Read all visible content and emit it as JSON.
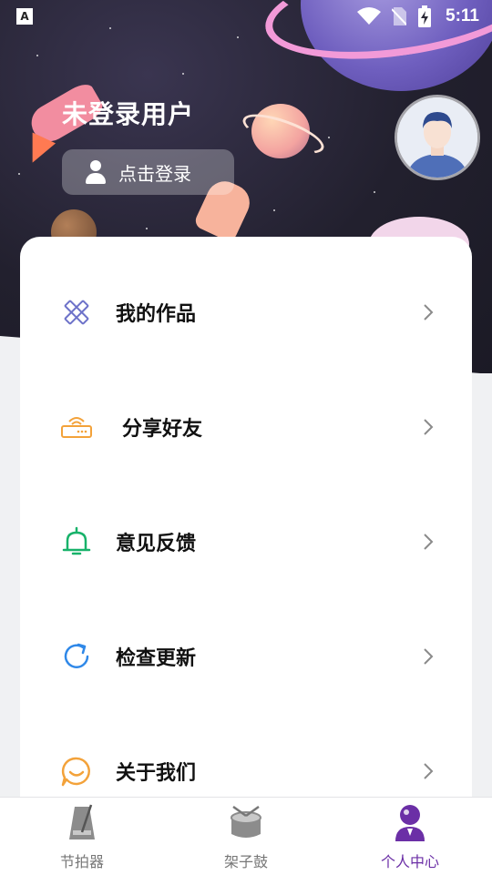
{
  "status_bar": {
    "time": "5:11",
    "app_icon_letter": "A"
  },
  "profile": {
    "username": "未登录用户",
    "login_label": "点击登录"
  },
  "menu": [
    {
      "label": "我的作品",
      "icon": "pencil-ruler-icon",
      "color": "#6d72c9"
    },
    {
      "label": "分享好友",
      "icon": "router-icon",
      "color": "#f3a23a"
    },
    {
      "label": "意见反馈",
      "icon": "bell-icon",
      "color": "#18b26a"
    },
    {
      "label": "检查更新",
      "icon": "refresh-icon",
      "color": "#2f88e8"
    },
    {
      "label": "关于我们",
      "icon": "chat-bubble-icon",
      "color": "#f3a23a"
    }
  ],
  "tabs": [
    {
      "label": "节拍器",
      "icon": "metronome-icon",
      "active": false
    },
    {
      "label": "架子鼓",
      "icon": "drum-icon",
      "active": false
    },
    {
      "label": "个人中心",
      "icon": "person-center-icon",
      "active": true
    }
  ],
  "colors": {
    "accent": "#6b2fa6",
    "chevron": "#8a8a8a"
  }
}
